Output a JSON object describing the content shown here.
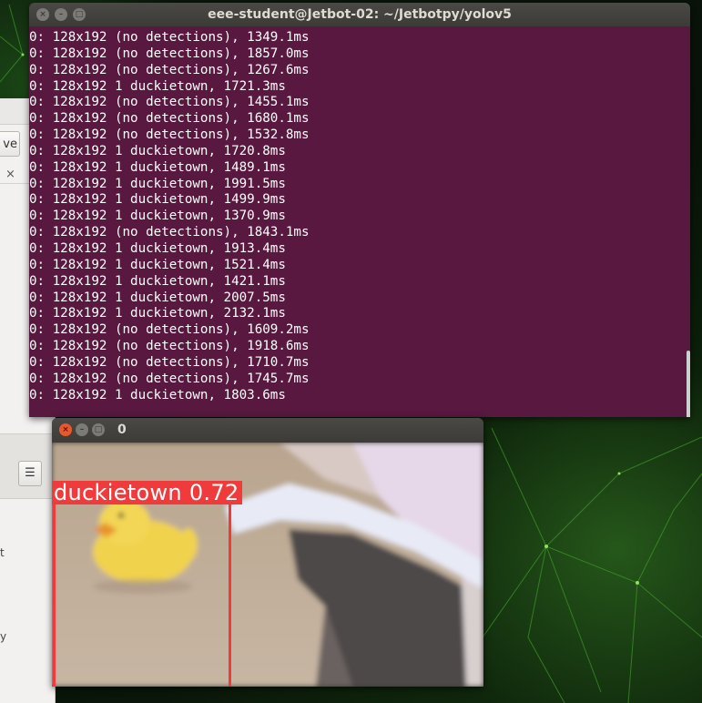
{
  "terminal": {
    "title": "eee-student@Jetbot-02: ~/Jetbotpy/yolov5",
    "lines": [
      "0: 128x192 (no detections), 1349.1ms",
      "0: 128x192 (no detections), 1857.0ms",
      "0: 128x192 (no detections), 1267.6ms",
      "0: 128x192 1 duckietown, 1721.3ms",
      "0: 128x192 (no detections), 1455.1ms",
      "0: 128x192 (no detections), 1680.1ms",
      "0: 128x192 (no detections), 1532.8ms",
      "0: 128x192 1 duckietown, 1720.8ms",
      "0: 128x192 1 duckietown, 1489.1ms",
      "0: 128x192 1 duckietown, 1991.5ms",
      "0: 128x192 1 duckietown, 1499.9ms",
      "0: 128x192 1 duckietown, 1370.9ms",
      "0: 128x192 (no detections), 1843.1ms",
      "0: 128x192 1 duckietown, 1913.4ms",
      "0: 128x192 1 duckietown, 1521.4ms",
      "0: 128x192 1 duckietown, 1421.1ms",
      "0: 128x192 1 duckietown, 2007.5ms",
      "0: 128x192 1 duckietown, 2132.1ms",
      "0: 128x192 (no detections), 1609.2ms",
      "0: 128x192 (no detections), 1918.6ms",
      "0: 128x192 (no detections), 1710.7ms",
      "0: 128x192 (no detections), 1745.7ms",
      "0: 128x192 1 duckietown, 1803.6ms"
    ],
    "buttons": {
      "close": "×",
      "minimize": "–",
      "maximize": "□"
    }
  },
  "image_window": {
    "title": "0",
    "detection_label": "duckietown  0.72",
    "buttons": {
      "close": "×",
      "minimize": "–",
      "maximize": "□"
    }
  },
  "background_window": {
    "save_label": "ve",
    "close_glyph": "×",
    "menu_glyph": "☰",
    "text_fragments": [
      "t",
      "y"
    ]
  },
  "colors": {
    "terminal_bg": "#58183f",
    "titlebar": "#3c3b37",
    "detection": "#ef3b3b"
  },
  "icons": {
    "menu": "hamburger-menu-icon",
    "close": "close-icon",
    "minimize": "minimize-icon",
    "maximize": "maximize-icon"
  }
}
